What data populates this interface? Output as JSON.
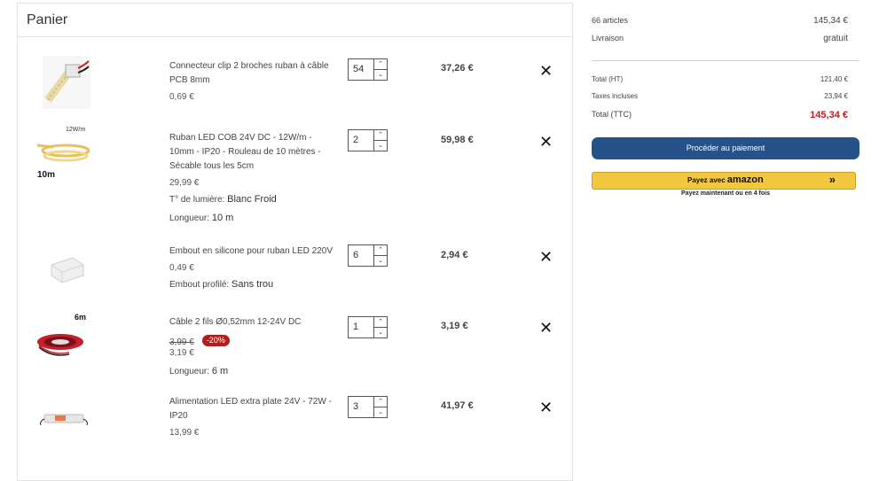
{
  "cart": {
    "title": "Panier",
    "items": [
      {
        "name": "Connecteur clip 2 broches ruban à câble PCB 8mm",
        "unit_price": "0,69 €",
        "qty": "54",
        "total": "37,26 €"
      },
      {
        "name": "Ruban LED COB 24V DC - 12W/m - 10mm - IP20 - Rouleau de 10 mètres - Sécable tous les 5cm",
        "unit_price": "29,99 €",
        "attr1_label": "T° de lumière:",
        "attr1_value": "Blanc Froid",
        "attr2_label": "Longueur:",
        "attr2_value": "10 m",
        "qty": "2",
        "total": "59,98 €",
        "thumb_label_top": "12W/m",
        "thumb_label_bottom": "10m"
      },
      {
        "name": "Embout en silicone pour ruban LED 220V",
        "unit_price": "0,49 €",
        "attr1_label": "Embout profilé:",
        "attr1_value": "Sans trou",
        "qty": "6",
        "total": "2,94 €"
      },
      {
        "name": "Câble 2 fils Ø0,52mm 12-24V DC",
        "old_price": "3,99 €",
        "discount": "-20%",
        "unit_price": "3,19 €",
        "attr1_label": "Longueur:",
        "attr1_value": "6 m",
        "qty": "1",
        "total": "3,19 €",
        "thumb_label_top": "6m"
      },
      {
        "name": "Alimentation LED extra plate 24V - 72W - IP20",
        "unit_price": "13,99 €",
        "qty": "3",
        "total": "41,97 €"
      }
    ]
  },
  "summary": {
    "articles_label": "66 articles",
    "articles_value": "145,34 €",
    "shipping_label": "Livraison",
    "shipping_value": "gratuit",
    "ht_label": "Total (HT)",
    "ht_value": "121,40 €",
    "tax_label": "Taxes incluses",
    "tax_value": "23,94 €",
    "ttc_label": "Total (TTC)",
    "ttc_value": "145,34 €",
    "checkout_button": "Procéder au paiement",
    "amazon_button": "Payez avec",
    "amazon_brand": "amazon",
    "amazon_sub": "Payez maintenant ou en 4 fois"
  },
  "colors": {
    "accent": "#26528a",
    "price_red": "#b51c1c",
    "amazon": "#f4c740"
  },
  "icons": {
    "remove": "close-icon",
    "qty_up": "chevron-up-icon",
    "qty_down": "chevron-down-icon"
  }
}
